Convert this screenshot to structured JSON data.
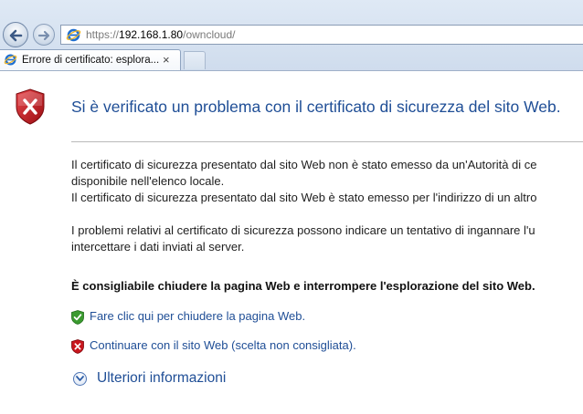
{
  "browser": {
    "url_scheme": "https://",
    "url_host": "192.168.1.80",
    "url_path": "/owncloud/",
    "tab_title": "Errore di certificato: esplora...",
    "tab_close": "×"
  },
  "page": {
    "title": "Si è verificato un problema con il certificato di sicurezza del sito Web.",
    "paragraph1": [
      "Il certificato di sicurezza presentato dal sito Web non è stato emesso da un'Autorità di ce",
      "disponibile nell'elenco locale.",
      "Il certificato di sicurezza presentato dal sito Web è stato emesso per l'indirizzo di un altro"
    ],
    "paragraph2": [
      "I problemi relativi al certificato di sicurezza possono indicare un tentativo di ingannare l'u",
      "intercettare i dati inviati al server."
    ],
    "recommendation": "È consigliabile chiudere la pagina Web e interrompere l'esplorazione del sito Web.",
    "close_link": "Fare clic qui per chiudere la pagina Web.",
    "continue_link": "Continuare con il sito Web (scelta non consigliata).",
    "more_info": "Ulteriori informazioni"
  },
  "colors": {
    "link": "#1f4e96",
    "title": "#1f4e96",
    "shield_red": "#c8161d",
    "shield_green": "#3a9a2f"
  }
}
